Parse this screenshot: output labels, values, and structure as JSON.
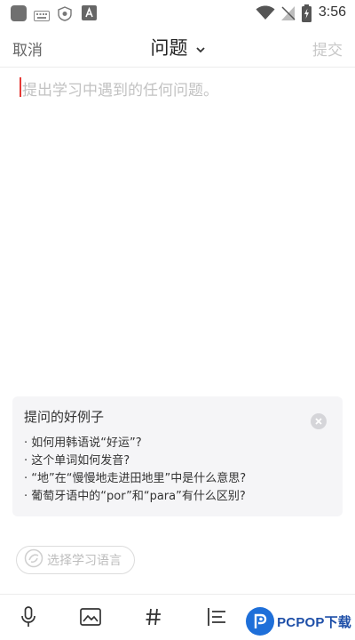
{
  "status_bar": {
    "time": "3:56",
    "icons": [
      "app-square-icon",
      "keyboard-icon",
      "shield-icon",
      "a-icon",
      "wifi-icon",
      "no-sim-icon",
      "battery-charging-icon"
    ]
  },
  "header": {
    "cancel_label": "取消",
    "title": "问题",
    "submit_label": "提交"
  },
  "editor": {
    "placeholder": "提出学习中遇到的任何问题。"
  },
  "examples": {
    "title": "提问的好例子",
    "items": [
      "· 如何用韩语说“好运”?",
      "· 这个单词如何发音?",
      "· “地”在“慢慢地走进田地里”中是什么意思?",
      "· 葡萄牙语中的“por”和“para”有什么区别?"
    ]
  },
  "language_selector": {
    "label": "选择学习语言"
  },
  "toolbar": {
    "icons": [
      "microphone-icon",
      "image-icon",
      "hashtag-icon",
      "list-format-icon"
    ]
  },
  "watermark": {
    "text": "PCPOP下载"
  },
  "colors": {
    "cursor": "#e53935",
    "placeholder": "#c2c2c2",
    "disabled_text": "#c8c8c8",
    "card_bg": "#f5f5f7",
    "watermark_blue": "#1e6fd9"
  }
}
